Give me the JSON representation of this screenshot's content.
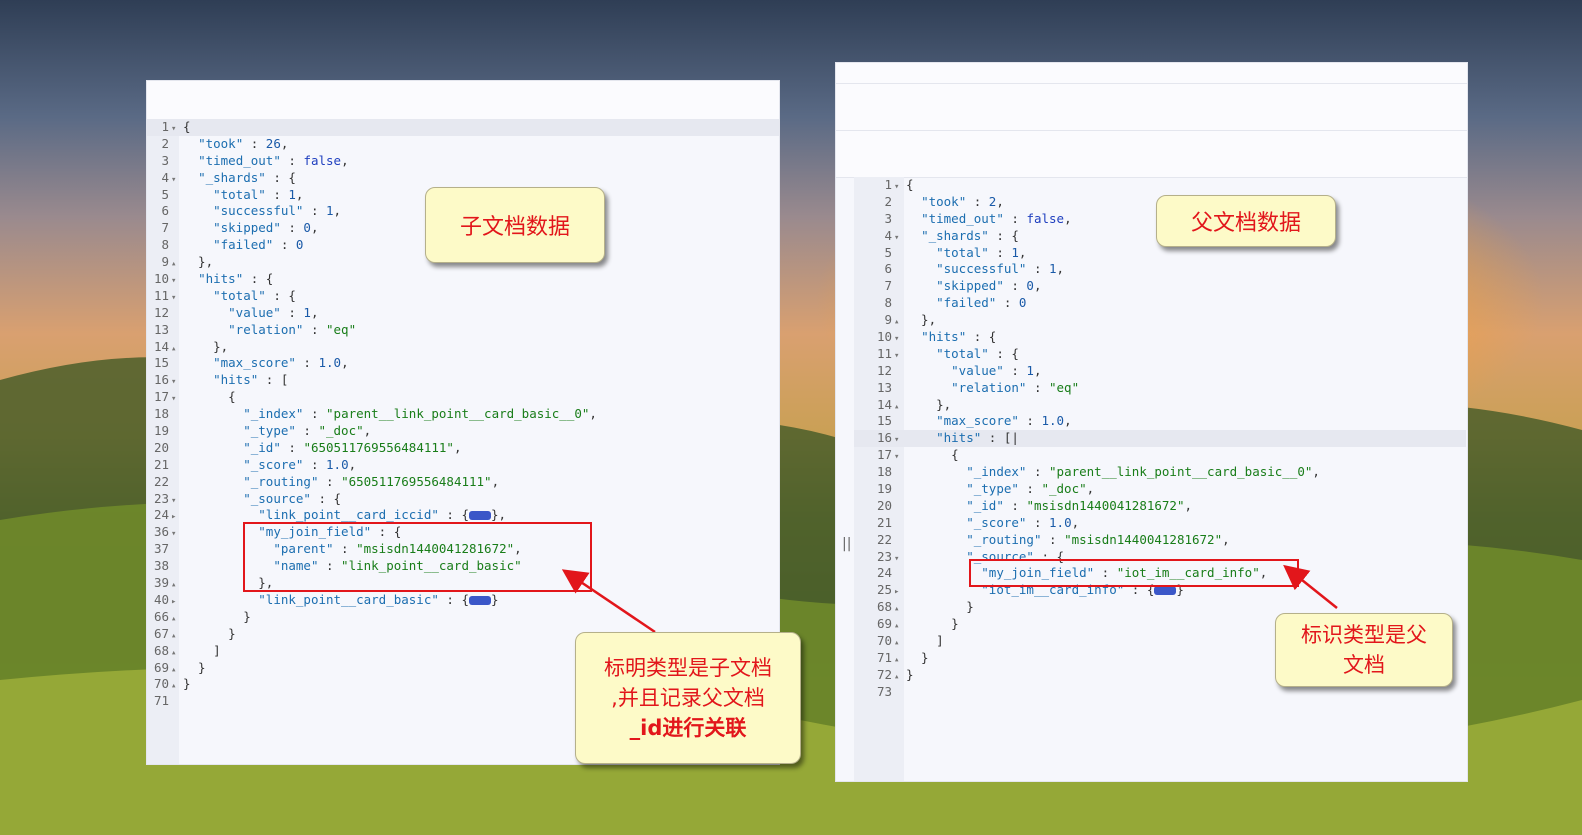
{
  "left_panel": {
    "lines": [
      {
        "n": "1",
        "fold": "v",
        "t": "{"
      },
      {
        "n": "2",
        "fold": "",
        "t": "  <k>\"took\"</k> : <n>26</n>,"
      },
      {
        "n": "3",
        "fold": "",
        "t": "  <k>\"timed_out\"</k> : <b>false</b>,"
      },
      {
        "n": "4",
        "fold": "v",
        "t": "  <k>\"_shards\"</k> : {"
      },
      {
        "n": "5",
        "fold": "",
        "t": "    <k>\"total\"</k> : <n>1</n>,"
      },
      {
        "n": "6",
        "fold": "",
        "t": "    <k>\"successful\"</k> : <n>1</n>,"
      },
      {
        "n": "7",
        "fold": "",
        "t": "    <k>\"skipped\"</k> : <n>0</n>,"
      },
      {
        "n": "8",
        "fold": "",
        "t": "    <k>\"failed\"</k> : <n>0</n>"
      },
      {
        "n": "9",
        "fold": "^",
        "t": "  },"
      },
      {
        "n": "10",
        "fold": "v",
        "t": "  <k>\"hits\"</k> : {"
      },
      {
        "n": "11",
        "fold": "v",
        "t": "    <k>\"total\"</k> : {"
      },
      {
        "n": "12",
        "fold": "",
        "t": "      <k>\"value\"</k> : <n>1</n>,"
      },
      {
        "n": "13",
        "fold": "",
        "t": "      <k>\"relation\"</k> : <s>\"eq\"</s>"
      },
      {
        "n": "14",
        "fold": "^",
        "t": "    },"
      },
      {
        "n": "15",
        "fold": "",
        "t": "    <k>\"max_score\"</k> : <n>1.0</n>,"
      },
      {
        "n": "16",
        "fold": "v",
        "t": "    <k>\"hits\"</k> : ["
      },
      {
        "n": "17",
        "fold": "v",
        "t": "      {"
      },
      {
        "n": "18",
        "fold": "",
        "t": "        <k>\"_index\"</k> : <s>\"parent__link_point__card_basic__0\"</s>,"
      },
      {
        "n": "19",
        "fold": "",
        "t": "        <k>\"_type\"</k> : <s>\"_doc\"</s>,"
      },
      {
        "n": "20",
        "fold": "",
        "t": "        <k>\"_id\"</k> : <s>\"650511769556484111\"</s>,"
      },
      {
        "n": "21",
        "fold": "",
        "t": "        <k>\"_score\"</k> : <n>1.0</n>,"
      },
      {
        "n": "22",
        "fold": "",
        "t": "        <k>\"_routing\"</k> : <s>\"650511769556484111\"</s>,"
      },
      {
        "n": "23",
        "fold": "v",
        "t": "        <k>\"_source\"</k> : {"
      },
      {
        "n": "24",
        "fold": ">",
        "t": "          <k>\"link_point__card_iccid\"</k> : {<c></c>},"
      },
      {
        "n": "36",
        "fold": "v",
        "t": "          <k>\"my_join_field\"</k> : {"
      },
      {
        "n": "37",
        "fold": "",
        "t": "            <k>\"parent\"</k> : <s>\"msisdn1440041281672\"</s>,"
      },
      {
        "n": "38",
        "fold": "",
        "t": "            <k>\"name\"</k> : <s>\"link_point__card_basic\"</s>"
      },
      {
        "n": "39",
        "fold": "^",
        "t": "          },"
      },
      {
        "n": "40",
        "fold": ">",
        "t": "          <k>\"link_point__card_basic\"</k> : {<c></c>}"
      },
      {
        "n": "66",
        "fold": "^",
        "t": "        }"
      },
      {
        "n": "67",
        "fold": "^",
        "t": "      }"
      },
      {
        "n": "68",
        "fold": "^",
        "t": "    ]"
      },
      {
        "n": "69",
        "fold": "^",
        "t": "  }"
      },
      {
        "n": "70",
        "fold": "^",
        "t": "}"
      },
      {
        "n": "71",
        "fold": "",
        "t": ""
      }
    ]
  },
  "right_panel": {
    "lines": [
      {
        "n": "1",
        "fold": "v",
        "t": "{"
      },
      {
        "n": "2",
        "fold": "",
        "t": "  <k>\"took\"</k> : <n>2</n>,"
      },
      {
        "n": "3",
        "fold": "",
        "t": "  <k>\"timed_out\"</k> : <b>false</b>,"
      },
      {
        "n": "4",
        "fold": "v",
        "t": "  <k>\"_shards\"</k> : {"
      },
      {
        "n": "5",
        "fold": "",
        "t": "    <k>\"total\"</k> : <n>1</n>,"
      },
      {
        "n": "6",
        "fold": "",
        "t": "    <k>\"successful\"</k> : <n>1</n>,"
      },
      {
        "n": "7",
        "fold": "",
        "t": "    <k>\"skipped\"</k> : <n>0</n>,"
      },
      {
        "n": "8",
        "fold": "",
        "t": "    <k>\"failed\"</k> : <n>0</n>"
      },
      {
        "n": "9",
        "fold": "^",
        "t": "  },"
      },
      {
        "n": "10",
        "fold": "v",
        "t": "  <k>\"hits\"</k> : {"
      },
      {
        "n": "11",
        "fold": "v",
        "t": "    <k>\"total\"</k> : {"
      },
      {
        "n": "12",
        "fold": "",
        "t": "      <k>\"value\"</k> : <n>1</n>,"
      },
      {
        "n": "13",
        "fold": "",
        "t": "      <k>\"relation\"</k> : <s>\"eq\"</s>"
      },
      {
        "n": "14",
        "fold": "^",
        "t": "    },"
      },
      {
        "n": "15",
        "fold": "",
        "t": "    <k>\"max_score\"</k> : <n>1.0</n>,"
      },
      {
        "n": "16",
        "fold": "v",
        "t": "    <k>\"hits\"</k> : [|"
      },
      {
        "n": "17",
        "fold": "v",
        "t": "      {"
      },
      {
        "n": "18",
        "fold": "",
        "t": "        <k>\"_index\"</k> : <s>\"parent__link_point__card_basic__0\"</s>,"
      },
      {
        "n": "19",
        "fold": "",
        "t": "        <k>\"_type\"</k> : <s>\"_doc\"</s>,"
      },
      {
        "n": "20",
        "fold": "",
        "t": "        <k>\"_id\"</k> : <s>\"msisdn1440041281672\"</s>,"
      },
      {
        "n": "21",
        "fold": "",
        "t": "        <k>\"_score\"</k> : <n>1.0</n>,"
      },
      {
        "n": "22",
        "fold": "",
        "t": "        <k>\"_routing\"</k> : <s>\"msisdn1440041281672\"</s>,"
      },
      {
        "n": "23",
        "fold": "v",
        "t": "        <k>\"_source\"</k> : {"
      },
      {
        "n": "24",
        "fold": "",
        "t": "          <k>\"my_join_field\"</k> : <s>\"iot_im__card_info\"</s>,"
      },
      {
        "n": "25",
        "fold": ">",
        "t": "          <k>\"iot_im__card_info\"</k> : {<c></c>}"
      },
      {
        "n": "68",
        "fold": "^",
        "t": "        }"
      },
      {
        "n": "69",
        "fold": "^",
        "t": "      }"
      },
      {
        "n": "70",
        "fold": "^",
        "t": "    ]"
      },
      {
        "n": "71",
        "fold": "^",
        "t": "  }"
      },
      {
        "n": "72",
        "fold": "^",
        "t": "}"
      },
      {
        "n": "73",
        "fold": "",
        "t": ""
      }
    ],
    "divider_glyph": "||"
  },
  "callouts": {
    "child_title": "子文档数据",
    "parent_title": "父文档数据",
    "child_note_1": "标明类型是子文档",
    "child_note_2": ",并且记录父文档",
    "child_note_3": "_id进行关联",
    "parent_note_1": "标识类型是父",
    "parent_note_2": "文档"
  },
  "colors": {
    "callout_text": "#e2161b",
    "highlight": "#e2161b"
  }
}
